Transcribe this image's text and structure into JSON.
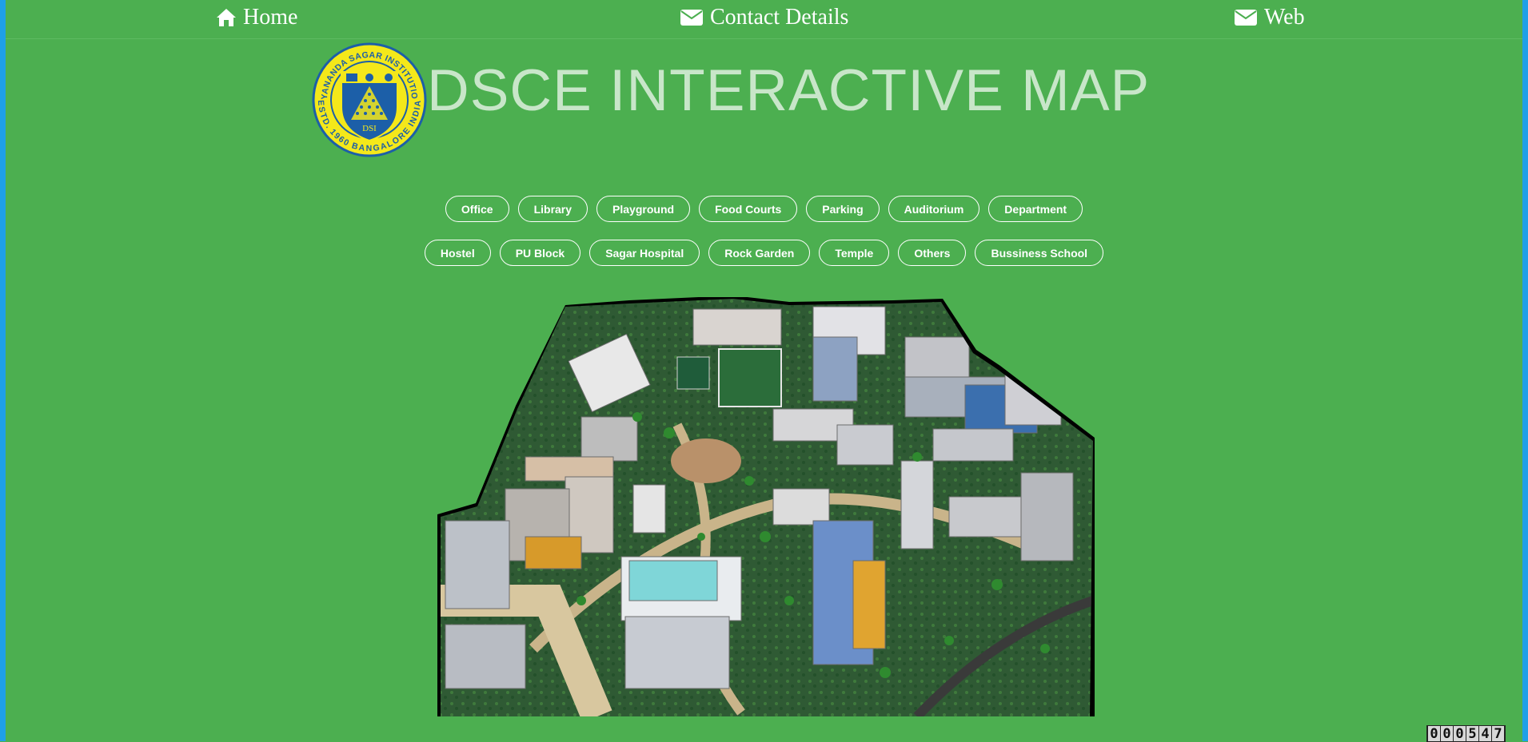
{
  "nav": {
    "home_label": "Home",
    "contact_label": "Contact Details",
    "web_label": "Web",
    "home_icon": "home-icon",
    "contact_icon": "envelope-icon",
    "web_icon": "envelope-icon"
  },
  "logo": {
    "ring_text_top": "DAYANANDA SAGAR INSTITUTIONS",
    "ring_text_bottom": "ESTD. 1960 BANGALORE INDIA",
    "shield_text": "DSI"
  },
  "header": {
    "title": "DSCE INTERACTIVE MAP"
  },
  "categories_row1": [
    "Office",
    "Library",
    "Playground",
    "Food Courts",
    "Parking",
    "Auditorium",
    "Department"
  ],
  "categories_row2": [
    "Hostel",
    "PU Block",
    "Sagar Hospital",
    "Rock Garden",
    "Temple",
    "Others",
    "Bussiness School"
  ],
  "counter": {
    "value": "000547"
  },
  "colors": {
    "background": "#4caf50",
    "title": "#c8e6c9",
    "side_border": "#1ea0e6",
    "logo_yellow": "#f4e81a",
    "logo_blue": "#1c5fa8"
  }
}
